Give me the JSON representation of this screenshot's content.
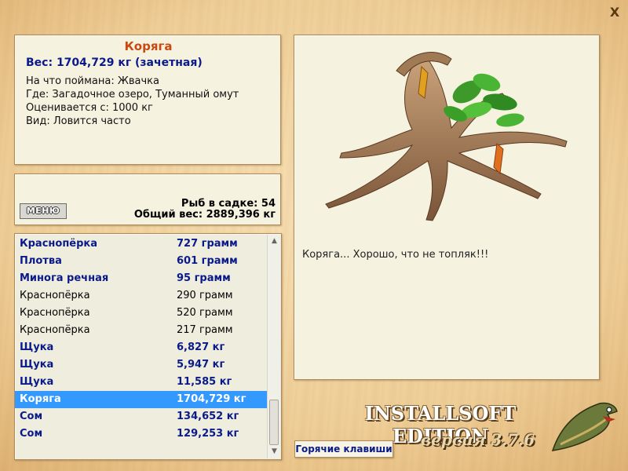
{
  "window": {
    "close_glyph": "X"
  },
  "fish": {
    "name": "Коряга",
    "weight_line": "Вес: 1704,729 кг (зачетная)",
    "bait": "На что поймана: Жвачка",
    "location": "Где: Загадочное озеро, Туманный омут",
    "rated_from": "Оценивается с: 1000 кг",
    "kind": "Вид: Ловится часто",
    "caption": "Коряга... Хорошо, что не топляк!!!"
  },
  "stats": {
    "menu_label": "МЕНЮ",
    "fish_count": "Рыб в садке: 54",
    "total_weight": "Общий вес: 2889,396 кг"
  },
  "catch_list": [
    {
      "name": "Краснопёрка",
      "weight": "727 грамм",
      "style": "hl"
    },
    {
      "name": "Плотва",
      "weight": "601 грамм",
      "style": "hl"
    },
    {
      "name": "Минога речная",
      "weight": "95 грамм",
      "style": "hl"
    },
    {
      "name": "Краснопёрка",
      "weight": "290 грамм",
      "style": "normal"
    },
    {
      "name": "Краснопёрка",
      "weight": "520 грамм",
      "style": "normal"
    },
    {
      "name": "Краснопёрка",
      "weight": "217 грамм",
      "style": "normal"
    },
    {
      "name": "Щука",
      "weight": "6,827 кг",
      "style": "hl"
    },
    {
      "name": "Щука",
      "weight": "5,947 кг",
      "style": "hl"
    },
    {
      "name": "Щука",
      "weight": "11,585 кг",
      "style": "hl"
    },
    {
      "name": "Коряга",
      "weight": "1704,729 кг",
      "style": "sel"
    },
    {
      "name": "Сом",
      "weight": "134,652 кг",
      "style": "hl"
    },
    {
      "name": "Сом",
      "weight": "129,253 кг",
      "style": "hl"
    }
  ],
  "brand": {
    "edition": "INSTALLSOFT EDITION",
    "version": "версия 3.7.6"
  },
  "hotkeys_label": "Горячие клавиши",
  "colors": {
    "title": "#c84a10",
    "highlight_text": "#0a1a8a",
    "selection": "#3399ff",
    "panel_bg": "#f6f2e0"
  }
}
